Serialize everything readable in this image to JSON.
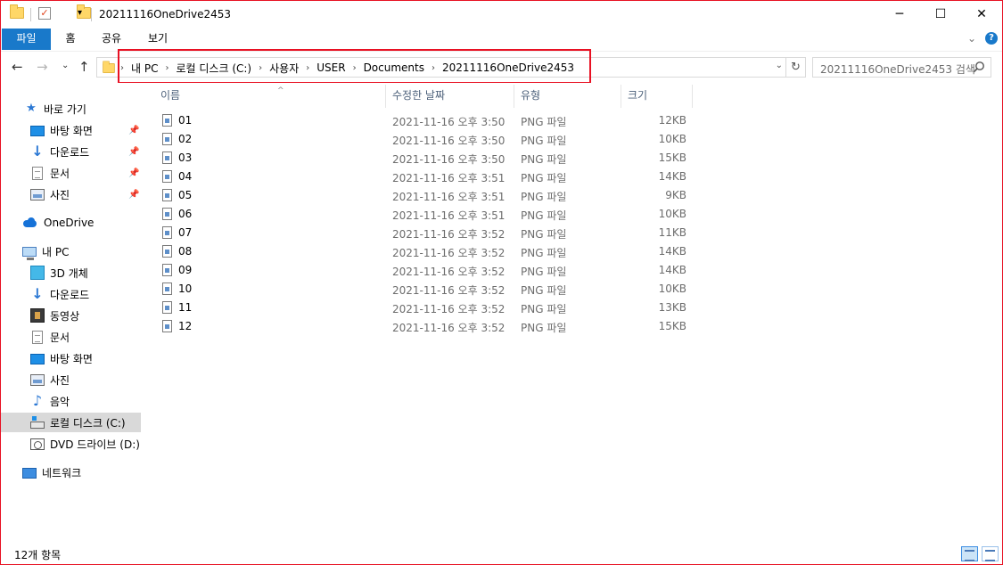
{
  "window": {
    "title": "20211116OneDrive2453",
    "minimize_glyph": "─",
    "maximize_glyph": "☐",
    "close_glyph": "✕"
  },
  "ribbon": {
    "tabs": [
      {
        "label": "파일"
      },
      {
        "label": "홈"
      },
      {
        "label": "공유"
      },
      {
        "label": "보기"
      }
    ],
    "expand_glyph": "⌄",
    "help_glyph": "?"
  },
  "address": {
    "breadcrumbs": [
      "내 PC",
      "로컬 디스크 (C:)",
      "사용자",
      "USER",
      "Documents",
      "20211116OneDrive2453"
    ],
    "search_placeholder": "20211116OneDrive2453 검색"
  },
  "nav": {
    "quick_access": "바로 가기",
    "quick_items": [
      {
        "label": "바탕 화면",
        "icon": "desktop-icon"
      },
      {
        "label": "다운로드",
        "icon": "download-icon"
      },
      {
        "label": "문서",
        "icon": "document-icon"
      },
      {
        "label": "사진",
        "icon": "picture-icon"
      }
    ],
    "onedrive": "OneDrive",
    "this_pc": "내 PC",
    "pc_items": [
      {
        "label": "3D 개체",
        "icon": "3d-objects-icon"
      },
      {
        "label": "다운로드",
        "icon": "download-icon"
      },
      {
        "label": "동영상",
        "icon": "video-icon"
      },
      {
        "label": "문서",
        "icon": "document-icon"
      },
      {
        "label": "바탕 화면",
        "icon": "desktop-icon"
      },
      {
        "label": "사진",
        "icon": "picture-icon"
      },
      {
        "label": "음악",
        "icon": "music-icon"
      },
      {
        "label": "로컬 디스크 (C:)",
        "icon": "local-disk-icon",
        "selected": true
      },
      {
        "label": "DVD 드라이브 (D:)",
        "icon": "dvd-drive-icon"
      }
    ],
    "network": "네트워크"
  },
  "columns": {
    "name": "이름",
    "date": "수정한 날짜",
    "type": "유형",
    "size": "크기"
  },
  "files": [
    {
      "name": "01",
      "date": "2021-11-16 오후 3:50",
      "type": "PNG 파일",
      "size": "12KB"
    },
    {
      "name": "02",
      "date": "2021-11-16 오후 3:50",
      "type": "PNG 파일",
      "size": "10KB"
    },
    {
      "name": "03",
      "date": "2021-11-16 오후 3:50",
      "type": "PNG 파일",
      "size": "15KB"
    },
    {
      "name": "04",
      "date": "2021-11-16 오후 3:51",
      "type": "PNG 파일",
      "size": "14KB"
    },
    {
      "name": "05",
      "date": "2021-11-16 오후 3:51",
      "type": "PNG 파일",
      "size": "9KB"
    },
    {
      "name": "06",
      "date": "2021-11-16 오후 3:51",
      "type": "PNG 파일",
      "size": "10KB"
    },
    {
      "name": "07",
      "date": "2021-11-16 오후 3:52",
      "type": "PNG 파일",
      "size": "11KB"
    },
    {
      "name": "08",
      "date": "2021-11-16 오후 3:52",
      "type": "PNG 파일",
      "size": "14KB"
    },
    {
      "name": "09",
      "date": "2021-11-16 오후 3:52",
      "type": "PNG 파일",
      "size": "14KB"
    },
    {
      "name": "10",
      "date": "2021-11-16 오후 3:52",
      "type": "PNG 파일",
      "size": "10KB"
    },
    {
      "name": "11",
      "date": "2021-11-16 오후 3:52",
      "type": "PNG 파일",
      "size": "13KB"
    },
    {
      "name": "12",
      "date": "2021-11-16 오후 3:52",
      "type": "PNG 파일",
      "size": "15KB"
    }
  ],
  "status": {
    "item_count": "12개 항목"
  },
  "colors": {
    "accent": "#1979ca",
    "highlight_border": "#e81123"
  }
}
